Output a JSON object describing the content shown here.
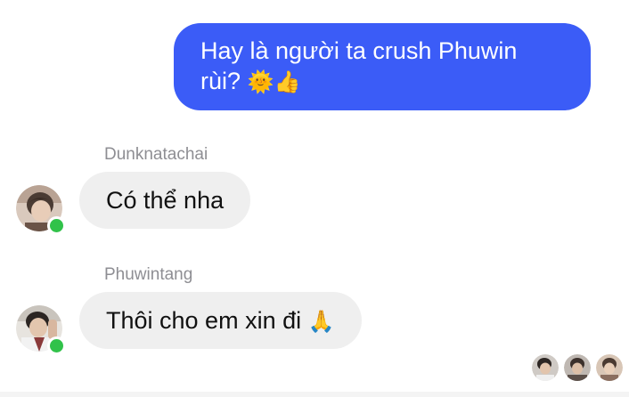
{
  "messages": {
    "outgoing": {
      "line1": "Hay là người ta crush Phuwin",
      "line2": "rùi?",
      "emoji1": "🌞",
      "emoji2": "👍"
    },
    "incoming": [
      {
        "sender": "Dunknatachai",
        "text": "Có thể nha",
        "emoji": ""
      },
      {
        "sender": "Phuwintang",
        "text": "Thôi cho em xin đi",
        "emoji": "🙏"
      }
    ]
  },
  "colors": {
    "outgoing_bubble": "#3b5cf7",
    "incoming_bubble": "#efefef",
    "online_dot": "#31c24a",
    "sender_name": "#8e8e93"
  },
  "icons": {
    "avatar_1": "dunknatachai-avatar",
    "avatar_2": "phuwintang-avatar",
    "online": "online-status-dot",
    "seen_receipts": [
      "seen-avatar-1",
      "seen-avatar-2",
      "seen-avatar-3"
    ]
  }
}
